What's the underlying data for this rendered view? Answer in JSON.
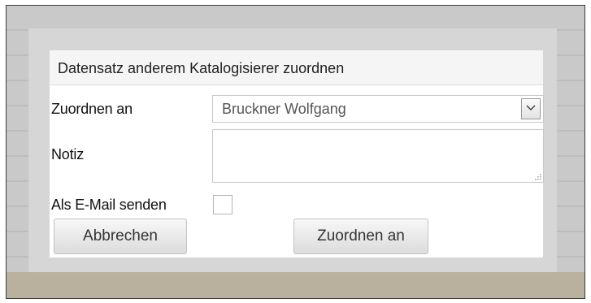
{
  "dialog": {
    "title": "Datensatz anderem Katalogisierer zuordnen"
  },
  "form": {
    "assign_to": {
      "label": "Zuordnen an",
      "selected_value": "Bruckner Wolfgang",
      "arrow_icon": "chevron-down-icon"
    },
    "note": {
      "label": "Notiz",
      "value": ""
    },
    "send_email": {
      "label": "Als E-Mail senden",
      "checked": false
    }
  },
  "buttons": {
    "cancel_label": "Abbrechen",
    "assign_label": "Zuordnen an"
  },
  "colors": {
    "page_background": "#c9c9c9",
    "dialog_frame": "#d6d6d6",
    "dialog_header": "#f5f5f5",
    "bottom_band": "#b9b19d"
  }
}
